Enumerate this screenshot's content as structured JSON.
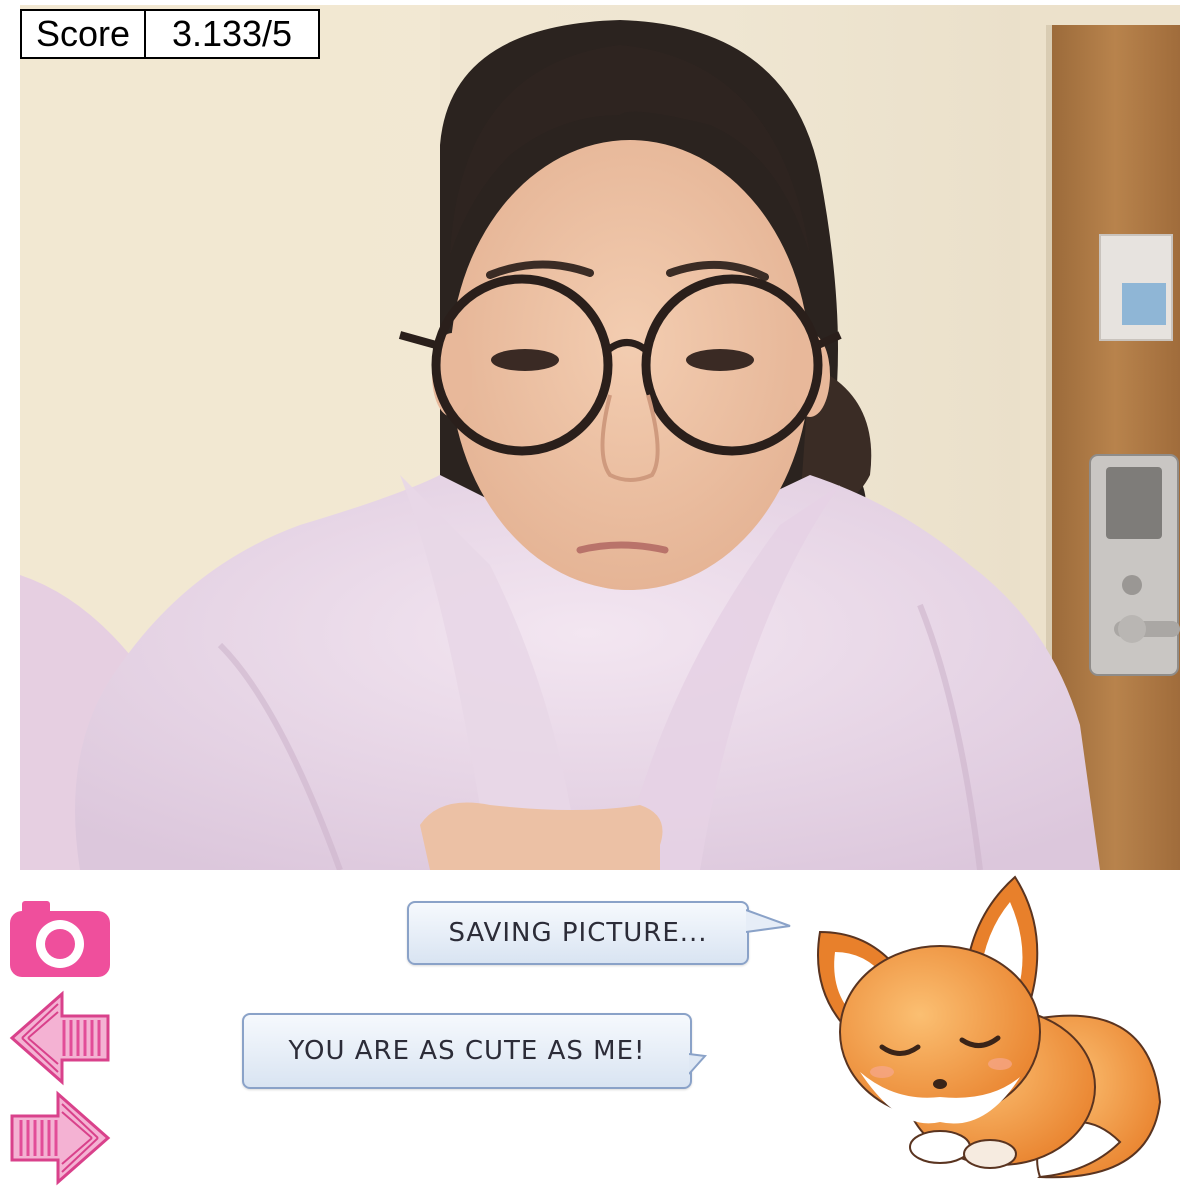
{
  "score": {
    "label": "Score",
    "value": "3.133/5"
  },
  "controls": [
    {
      "name": "camera-icon",
      "action": "take-photo"
    },
    {
      "name": "arrow-left-icon",
      "action": "previous"
    },
    {
      "name": "arrow-right-icon",
      "action": "next"
    }
  ],
  "messages": [
    {
      "text": "SAVING PICTURE..."
    },
    {
      "text": "YOU ARE AS CUTE AS ME!"
    }
  ],
  "colors": {
    "accent_pink": "#ef4f9c",
    "bubble_border": "#8aa2c8",
    "fox_orange": "#f0923a"
  },
  "mascot": {
    "icon": "fox-mascot-icon"
  }
}
